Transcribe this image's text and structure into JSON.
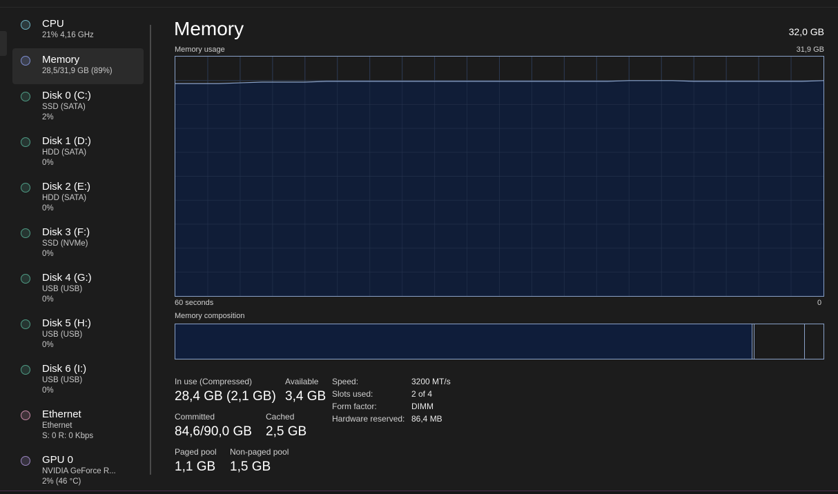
{
  "sidebar": {
    "items": [
      {
        "title": "CPU",
        "line1": "21%  4,16 GHz",
        "line2": "",
        "color": "#6fb4c4"
      },
      {
        "title": "Memory",
        "line1": "28,5/31,9 GB (89%)",
        "line2": "",
        "color": "#7f8fd2"
      },
      {
        "title": "Disk 0 (C:)",
        "line1": "SSD (SATA)",
        "line2": "2%",
        "color": "#4f9d86"
      },
      {
        "title": "Disk 1 (D:)",
        "line1": "HDD (SATA)",
        "line2": "0%",
        "color": "#4f9d86"
      },
      {
        "title": "Disk 2 (E:)",
        "line1": "HDD (SATA)",
        "line2": "0%",
        "color": "#4f9d86"
      },
      {
        "title": "Disk 3 (F:)",
        "line1": "SSD (NVMe)",
        "line2": "0%",
        "color": "#4f9d86"
      },
      {
        "title": "Disk 4 (G:)",
        "line1": "USB (USB)",
        "line2": "0%",
        "color": "#4f9d86"
      },
      {
        "title": "Disk 5 (H:)",
        "line1": "USB (USB)",
        "line2": "0%",
        "color": "#4f9d86"
      },
      {
        "title": "Disk 6 (I:)",
        "line1": "USB (USB)",
        "line2": "0%",
        "color": "#4f9d86"
      },
      {
        "title": "Ethernet",
        "line1": "Ethernet",
        "line2": "S: 0 R: 0 Kbps",
        "color": "#c98aa8"
      },
      {
        "title": "GPU 0",
        "line1": "NVIDIA GeForce R...",
        "line2": "2%  (46 °C)",
        "color": "#9c86c2"
      }
    ]
  },
  "main": {
    "title": "Memory",
    "total": "32,0 GB",
    "usage_label": "Memory usage",
    "usage_max": "31,9 GB",
    "axis_left": "60 seconds",
    "axis_right": "0",
    "composition_label": "Memory composition"
  },
  "stats": {
    "in_use_label": "In use (Compressed)",
    "in_use_value": "28,4 GB (2,1 GB)",
    "available_label": "Available",
    "available_value": "3,4 GB",
    "committed_label": "Committed",
    "committed_value": "84,6/90,0 GB",
    "cached_label": "Cached",
    "cached_value": "2,5 GB",
    "paged_label": "Paged pool",
    "paged_value": "1,1 GB",
    "nonpaged_label": "Non-paged pool",
    "nonpaged_value": "1,5 GB"
  },
  "specs": {
    "speed_label": "Speed:",
    "speed_value": "3200 MT/s",
    "slots_label": "Slots used:",
    "slots_value": "2 of 4",
    "form_label": "Form factor:",
    "form_value": "DIMM",
    "hwres_label": "Hardware reserved:",
    "hwres_value": "86,4 MB"
  },
  "chart_data": {
    "type": "area",
    "x": [
      60,
      58,
      56,
      54,
      52,
      50,
      48,
      46,
      44,
      42,
      40,
      38,
      36,
      34,
      32,
      30,
      28,
      26,
      24,
      22,
      20,
      18,
      16,
      14,
      12,
      10,
      8,
      6,
      4,
      2,
      0
    ],
    "values": [
      28.3,
      28.3,
      28.3,
      28.4,
      28.5,
      28.5,
      28.5,
      28.6,
      28.6,
      28.6,
      28.6,
      28.6,
      28.6,
      28.6,
      28.6,
      28.6,
      28.6,
      28.6,
      28.6,
      28.6,
      28.6,
      28.7,
      28.7,
      28.7,
      28.6,
      28.6,
      28.6,
      28.6,
      28.6,
      28.6,
      28.7
    ],
    "ylim": [
      0,
      31.9
    ],
    "xlabel": "60 seconds",
    "grid": true,
    "colors": {
      "fill": "#0f1d3a",
      "line": "#8aa2c9",
      "grid": "#2c3a52"
    }
  },
  "composition": {
    "in_use_gb": 28.4,
    "modified_gb": 0.1,
    "standby_gb": 2.5,
    "total_gb": 31.9
  }
}
